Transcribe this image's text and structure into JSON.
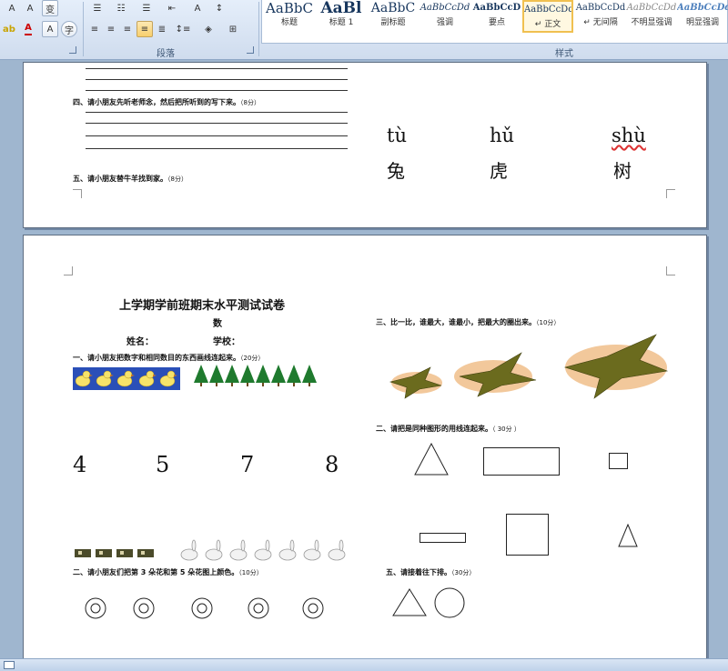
{
  "ribbon": {
    "paragraph_group_label": "段落",
    "styles_group_label": "样式",
    "styles": [
      {
        "sample": "AaBbC",
        "label": "标题",
        "selected": false
      },
      {
        "sample": "AaBl",
        "label": "标题 1",
        "selected": false
      },
      {
        "sample": "AaBbC",
        "label": "副标题",
        "selected": false
      },
      {
        "sample": "AaBbCcDd",
        "label": "强调",
        "selected": false
      },
      {
        "sample": "AaBbCcD",
        "label": "要点",
        "selected": false
      },
      {
        "sample": "AaBbCcDd",
        "label": "↵ 正文",
        "selected": true
      },
      {
        "sample": "AaBbCcDd",
        "label": "↵ 无间隔",
        "selected": false
      },
      {
        "sample": "AaBbCcDd",
        "label": "不明显强调",
        "selected": false
      },
      {
        "sample": "AaBbCcDd",
        "label": "明显强调",
        "selected": false
      }
    ]
  },
  "page1": {
    "q4": "四、请小朋友先听老师念，然后把所听到的写下来。",
    "q4_points": "（8分）",
    "q5": "五、请小朋友替牛羊找到家。",
    "q5_points": "（8分）",
    "pinyin": [
      "tù",
      "hǔ",
      "shù"
    ],
    "hanzi": [
      "兔",
      "虎",
      "树"
    ]
  },
  "page2": {
    "title": "上学期学前班期末水平测试试卷",
    "subject": "数",
    "name_label": "姓名：",
    "school_label": "学校：",
    "q1": "一、请小朋友把数字和相同数目的东西画线连起来。",
    "q1_points": "（20分）",
    "numbers": [
      "4",
      "5",
      "7",
      "8"
    ],
    "q2": "二、请小朋友们把第 3 朵花和第 5 朵花图上颜色。",
    "q2_points": "（10分）",
    "q3": "三、比一比，谁最大，谁最小，把最大的圈出来。",
    "q3_points": "（10分）",
    "q_shapes": "二、请把是同种图形的用线连起来。",
    "q_shapes_points": "（ 30分 ）",
    "q_sequence": "五、请接着往下排。",
    "q_sequence_points": "（30分）"
  },
  "colors": {
    "ribbon_bg": "#d6e3f4",
    "app_bg": "#9fb6cf",
    "duck_bg": "#2a4fb8",
    "tree": "#1f7a2e",
    "bird": "#6b6b1e"
  }
}
